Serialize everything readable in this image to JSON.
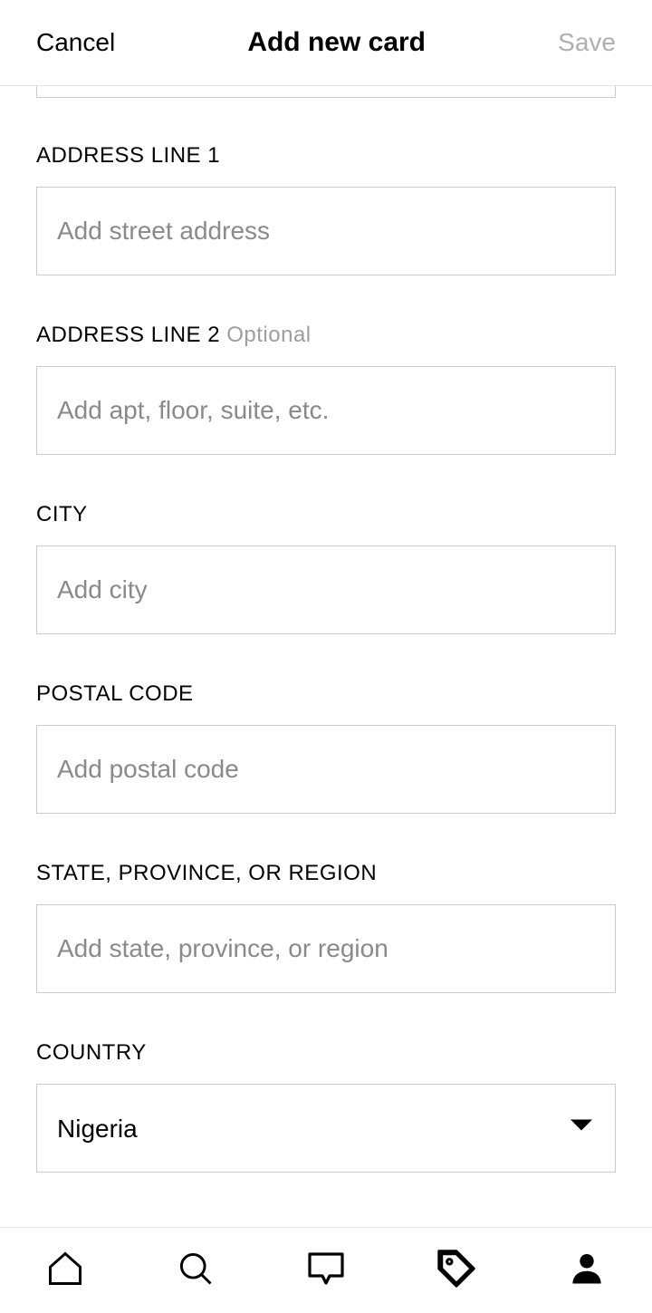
{
  "header": {
    "cancel": "Cancel",
    "title": "Add new card",
    "save": "Save"
  },
  "fields": {
    "address1": {
      "label": "ADDRESS LINE 1",
      "placeholder": "Add street address",
      "value": ""
    },
    "address2": {
      "label": "ADDRESS LINE 2",
      "optional": "Optional",
      "placeholder": "Add apt, floor, suite, etc.",
      "value": ""
    },
    "city": {
      "label": "CITY",
      "placeholder": "Add city",
      "value": ""
    },
    "postal": {
      "label": "POSTAL CODE",
      "placeholder": "Add postal code",
      "value": ""
    },
    "state": {
      "label": "STATE, PROVINCE, OR REGION",
      "placeholder": "Add state, province, or region",
      "value": ""
    },
    "country": {
      "label": "COUNTRY",
      "value": "Nigeria"
    }
  },
  "nav": {
    "home": "home-icon",
    "search": "search-icon",
    "inbox": "inbox-icon",
    "tag": "tag-icon",
    "profile": "profile-icon"
  }
}
